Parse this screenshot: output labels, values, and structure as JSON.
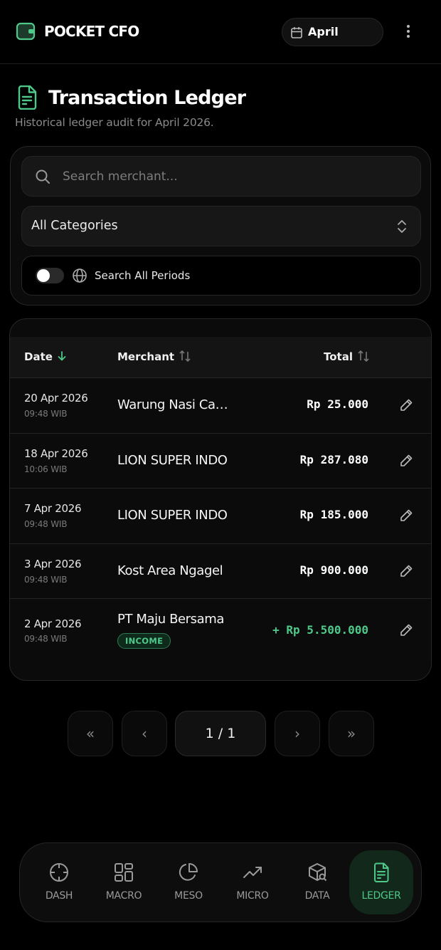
{
  "app": {
    "title": "POCKET CFO",
    "month": "April"
  },
  "page": {
    "title": "Transaction Ledger",
    "subtitle": "Historical ledger audit for April 2026."
  },
  "filters": {
    "search_placeholder": "Search merchant...",
    "category": "All Categories",
    "toggle_label": "Search All Periods",
    "toggle_on": false
  },
  "table": {
    "columns": {
      "date": "Date",
      "merchant": "Merchant",
      "total": "Total"
    },
    "rows": [
      {
        "date": "20 Apr 2026",
        "time": "09:48 WIB",
        "merchant": "Warung Nasi Campur Bu Tini",
        "total": "Rp 25.000",
        "type": "expense"
      },
      {
        "date": "18 Apr 2026",
        "time": "10:06 WIB",
        "merchant": "LION SUPER INDO",
        "total": "Rp 287.080",
        "type": "expense"
      },
      {
        "date": "7 Apr 2026",
        "time": "09:48 WIB",
        "merchant": "LION SUPER INDO",
        "total": "Rp 185.000",
        "type": "expense"
      },
      {
        "date": "3 Apr 2026",
        "time": "09:48 WIB",
        "merchant": "Kost Area Ngagel",
        "total": "Rp 900.000",
        "type": "expense"
      },
      {
        "date": "2 Apr 2026",
        "time": "09:48 WIB",
        "merchant": "PT Maju Bersama",
        "total": "+ Rp 5.500.000",
        "type": "income",
        "badge": "INCOME"
      }
    ]
  },
  "pagination": {
    "first": "«",
    "prev": "‹",
    "indicator": "1 / 1",
    "next": "›",
    "last": "»"
  },
  "nav": [
    {
      "label": "DASH",
      "icon": "crosshair-icon"
    },
    {
      "label": "MACRO",
      "icon": "grid-icon"
    },
    {
      "label": "MESO",
      "icon": "pie-chart-icon"
    },
    {
      "label": "MICRO",
      "icon": "trending-up-icon"
    },
    {
      "label": "DATA",
      "icon": "package-search-icon"
    },
    {
      "label": "LEDGER",
      "icon": "file-text-icon",
      "active": true
    }
  ],
  "colors": {
    "accent": "#4fc98a",
    "background": "#000000",
    "card": "#0b0b0b"
  }
}
